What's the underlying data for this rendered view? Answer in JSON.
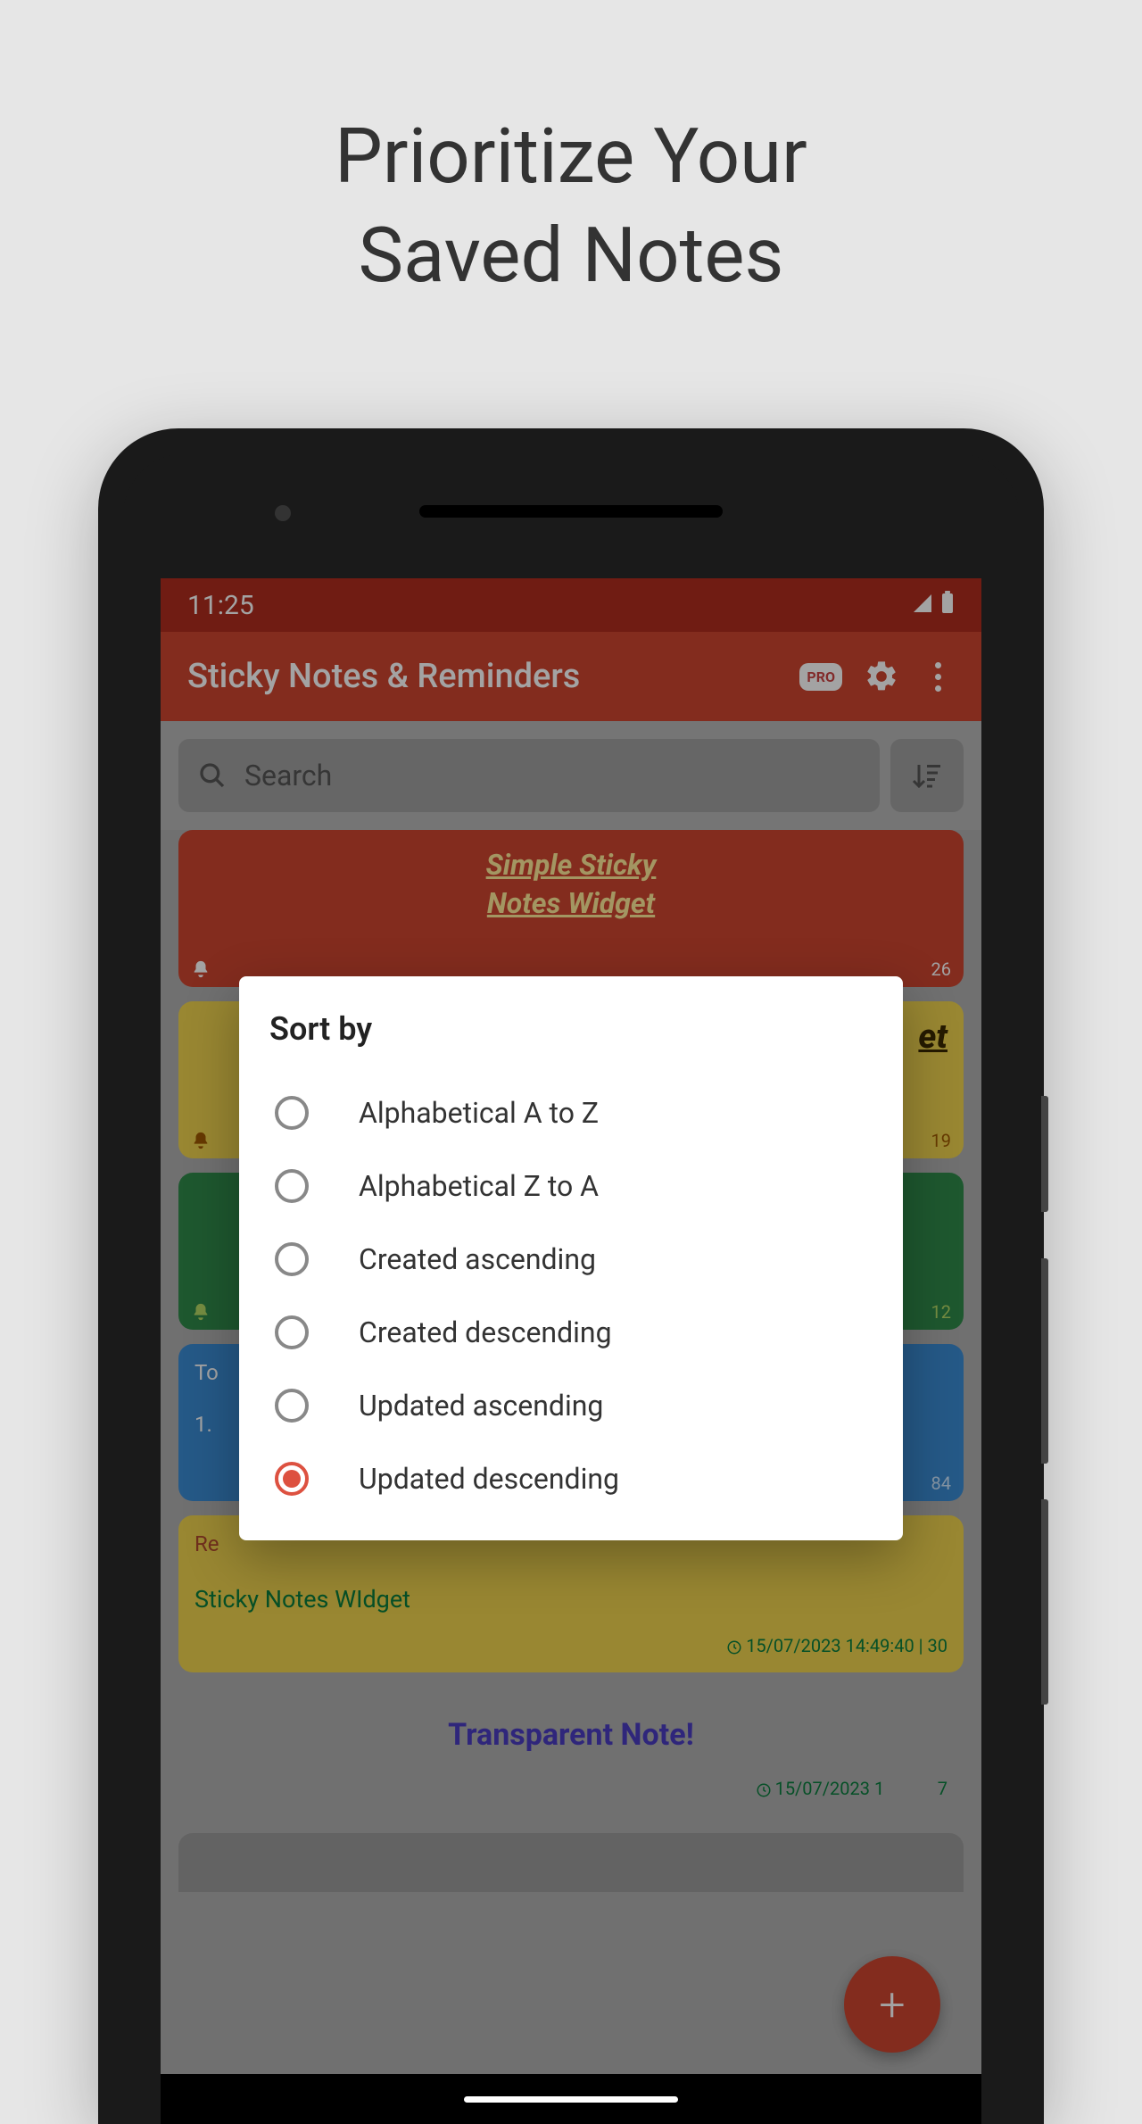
{
  "page": {
    "title_line1": "Prioritize Your",
    "title_line2": "Saved Notes"
  },
  "status": {
    "time": "11:25"
  },
  "appbar": {
    "title": "Sticky Notes & Reminders",
    "pro_label": "PRO"
  },
  "search": {
    "placeholder": "Search"
  },
  "notes": {
    "n1": {
      "title_l1": "Simple Sticky",
      "title_l2": "Notes Widget",
      "count": "26"
    },
    "n2": {
      "title_suffix": "et",
      "count": "19"
    },
    "n3": {
      "count": "12"
    },
    "n4": {
      "head_prefix": "To",
      "line_prefix": "1.",
      "count": "84"
    },
    "n5": {
      "head_prefix": "Re",
      "line": "Sticky Notes WIdget",
      "footer": "15/07/2023 14:49:40 | 30"
    },
    "n6": {
      "title": "Transparent Note!",
      "footer_prefix": "15/07/2023 1",
      "footer_suffix": "7"
    }
  },
  "dialog": {
    "title": "Sort by",
    "options": [
      "Alphabetical A to Z",
      "Alphabetical Z to A",
      "Created ascending",
      "Created descending",
      "Updated ascending",
      "Updated descending"
    ],
    "selected_index": 5
  }
}
